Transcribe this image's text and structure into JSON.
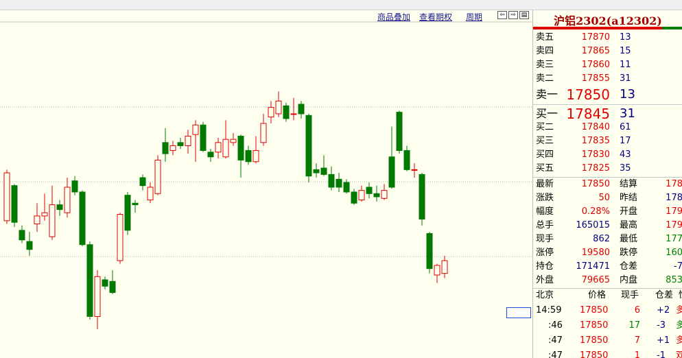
{
  "toolbar": {
    "overlay_label": "商品叠加",
    "options_label": "查看期权",
    "period_label": "周期",
    "nav_icons": [
      "arrow-left-icon",
      "arrow-right-icon",
      "panel-toggle-icon"
    ]
  },
  "instrument": {
    "title": "沪铝2302(a12302)"
  },
  "order_book": {
    "asks": [
      {
        "label": "卖五",
        "price": "17870",
        "volume": "13"
      },
      {
        "label": "卖四",
        "price": "17865",
        "volume": "15"
      },
      {
        "label": "卖三",
        "price": "17860",
        "volume": "11"
      },
      {
        "label": "卖二",
        "price": "17855",
        "volume": "31"
      },
      {
        "label": "卖一",
        "price": "17850",
        "volume": "13"
      }
    ],
    "bids": [
      {
        "label": "买一",
        "price": "17845",
        "volume": "31"
      },
      {
        "label": "买二",
        "price": "17840",
        "volume": "61"
      },
      {
        "label": "买三",
        "price": "17835",
        "volume": "17"
      },
      {
        "label": "买四",
        "price": "17830",
        "volume": "43"
      },
      {
        "label": "买五",
        "price": "17825",
        "volume": "35"
      }
    ]
  },
  "stats": [
    {
      "l1": "最新",
      "v1": "17850",
      "c1": "red",
      "l2": "结算",
      "v2": "178",
      "c2": "red"
    },
    {
      "l1": "涨跌",
      "v1": "50",
      "c1": "red",
      "l2": "昨结",
      "v2": "178",
      "c2": "navy"
    },
    {
      "l1": "幅度",
      "v1": "0.28%",
      "c1": "red",
      "l2": "开盘",
      "v2": "179",
      "c2": "red"
    },
    {
      "l1": "总手",
      "v1": "165015",
      "c1": "navy",
      "l2": "最高",
      "v2": "179",
      "c2": "red"
    },
    {
      "l1": "现手",
      "v1": "862",
      "c1": "navy",
      "l2": "最低",
      "v2": "177",
      "c2": "green"
    },
    {
      "l1": "涨停",
      "v1": "19580",
      "c1": "red",
      "l2": "跌停",
      "v2": "160",
      "c2": "green"
    },
    {
      "l1": "持仓",
      "v1": "171471",
      "c1": "navy",
      "l2": "仓差",
      "v2": "-7",
      "c2": "navy"
    },
    {
      "l1": "外盘",
      "v1": "79665",
      "c1": "red",
      "l2": "内盘",
      "v2": "853",
      "c2": "green"
    }
  ],
  "ticks_header": {
    "time": "北京",
    "price": "价格",
    "volume": "现手",
    "oi": "仓差",
    "type": "性"
  },
  "ticks": [
    {
      "time": "14:59",
      "price": "17850",
      "volume": "6",
      "volume_color": "red",
      "oi": "+2",
      "type": "多",
      "type_color": "red"
    },
    {
      "time": ":46",
      "price": "17850",
      "volume": "17",
      "volume_color": "green",
      "oi": "-3",
      "type": "多",
      "type_color": "green"
    },
    {
      "time": ":47",
      "price": "17850",
      "volume": "7",
      "volume_color": "red",
      "oi": "+1",
      "type": "多",
      "type_color": "red"
    },
    {
      "time": ":47",
      "price": "17850",
      "volume": "1",
      "volume_color": "red",
      "oi": "-1",
      "type": "双",
      "type_color": "red"
    }
  ],
  "colors": {
    "up": "#e00000",
    "down": "#007a00",
    "grid": "#b8b8b8",
    "background": "#fffff0"
  },
  "chart_data": {
    "type": "candlestick",
    "candles": [
      {
        "o": 17455,
        "c": 17605,
        "h": 17615,
        "l": 17445
      },
      {
        "o": 17565,
        "c": 17450,
        "h": 17570,
        "l": 17435
      },
      {
        "o": 17425,
        "c": 17395,
        "h": 17440,
        "l": 17385
      },
      {
        "o": 17390,
        "c": 17365,
        "h": 17420,
        "l": 17345
      },
      {
        "o": 17445,
        "c": 17470,
        "h": 17510,
        "l": 17420
      },
      {
        "o": 17470,
        "c": 17480,
        "h": 17540,
        "l": 17455
      },
      {
        "o": 17405,
        "c": 17505,
        "h": 17565,
        "l": 17395
      },
      {
        "o": 17505,
        "c": 17490,
        "h": 17520,
        "l": 17470
      },
      {
        "o": 17480,
        "c": 17560,
        "h": 17590,
        "l": 17465
      },
      {
        "o": 17580,
        "c": 17545,
        "h": 17595,
        "l": 17535
      },
      {
        "o": 17545,
        "c": 17380,
        "h": 17550,
        "l": 17375
      },
      {
        "o": 17380,
        "c": 17155,
        "h": 17390,
        "l": 17145
      },
      {
        "o": 17155,
        "c": 17280,
        "h": 17300,
        "l": 17115
      },
      {
        "o": 17270,
        "c": 17250,
        "h": 17280,
        "l": 17240
      },
      {
        "o": 17265,
        "c": 17230,
        "h": 17300,
        "l": 17225
      },
      {
        "o": 17330,
        "c": 17475,
        "h": 17480,
        "l": 17320
      },
      {
        "o": 17535,
        "c": 17425,
        "h": 17545,
        "l": 17410
      },
      {
        "o": 17510,
        "c": 17505,
        "h": 17520,
        "l": 17480
      },
      {
        "o": 17590,
        "c": 17565,
        "h": 17600,
        "l": 17550
      },
      {
        "o": 17520,
        "c": 17560,
        "h": 17575,
        "l": 17510
      },
      {
        "o": 17540,
        "c": 17645,
        "h": 17660,
        "l": 17535
      },
      {
        "o": 17700,
        "c": 17665,
        "h": 17745,
        "l": 17640
      },
      {
        "o": 17675,
        "c": 17690,
        "h": 17705,
        "l": 17660
      },
      {
        "o": 17700,
        "c": 17690,
        "h": 17715,
        "l": 17680
      },
      {
        "o": 17690,
        "c": 17720,
        "h": 17740,
        "l": 17665
      },
      {
        "o": 17725,
        "c": 17755,
        "h": 17770,
        "l": 17640
      },
      {
        "o": 17755,
        "c": 17675,
        "h": 17765,
        "l": 17670
      },
      {
        "o": 17670,
        "c": 17655,
        "h": 17680,
        "l": 17640
      },
      {
        "o": 17670,
        "c": 17700,
        "h": 17715,
        "l": 17650
      },
      {
        "o": 17655,
        "c": 17710,
        "h": 17770,
        "l": 17650
      },
      {
        "o": 17700,
        "c": 17710,
        "h": 17730,
        "l": 17690
      },
      {
        "o": 17720,
        "c": 17645,
        "h": 17725,
        "l": 17590
      },
      {
        "o": 17675,
        "c": 17640,
        "h": 17690,
        "l": 17630
      },
      {
        "o": 17640,
        "c": 17675,
        "h": 17720,
        "l": 17635
      },
      {
        "o": 17700,
        "c": 17760,
        "h": 17790,
        "l": 17690
      },
      {
        "o": 17780,
        "c": 17810,
        "h": 17830,
        "l": 17760
      },
      {
        "o": 17790,
        "c": 17830,
        "h": 17860,
        "l": 17780
      },
      {
        "o": 17815,
        "c": 17775,
        "h": 17825,
        "l": 17765
      },
      {
        "o": 17790,
        "c": 17790,
        "h": 17840,
        "l": 17770
      },
      {
        "o": 17820,
        "c": 17790,
        "h": 17830,
        "l": 17775
      },
      {
        "o": 17785,
        "c": 17595,
        "h": 17790,
        "l": 17575
      },
      {
        "o": 17615,
        "c": 17605,
        "h": 17635,
        "l": 17590
      },
      {
        "o": 17620,
        "c": 17600,
        "h": 17660,
        "l": 17595
      },
      {
        "o": 17600,
        "c": 17560,
        "h": 17625,
        "l": 17550
      },
      {
        "o": 17585,
        "c": 17560,
        "h": 17605,
        "l": 17545
      },
      {
        "o": 17575,
        "c": 17545,
        "h": 17585,
        "l": 17540
      },
      {
        "o": 17545,
        "c": 17510,
        "h": 17555,
        "l": 17505
      },
      {
        "o": 17520,
        "c": 17550,
        "h": 17565,
        "l": 17515
      },
      {
        "o": 17560,
        "c": 17540,
        "h": 17575,
        "l": 17525
      },
      {
        "o": 17540,
        "c": 17530,
        "h": 17565,
        "l": 17515
      },
      {
        "o": 17525,
        "c": 17550,
        "h": 17570,
        "l": 17520
      },
      {
        "o": 17655,
        "c": 17560,
        "h": 17750,
        "l": 17555
      },
      {
        "o": 17795,
        "c": 17675,
        "h": 17800,
        "l": 17665
      },
      {
        "o": 17675,
        "c": 17615,
        "h": 17690,
        "l": 17610
      },
      {
        "o": 17615,
        "c": 17615,
        "h": 17635,
        "l": 17590
      },
      {
        "o": 17600,
        "c": 17460,
        "h": 17605,
        "l": 17440
      },
      {
        "o": 17415,
        "c": 17305,
        "h": 17420,
        "l": 17290
      },
      {
        "o": 17285,
        "c": 17315,
        "h": 17320,
        "l": 17260
      },
      {
        "o": 17290,
        "c": 17330,
        "h": 17345,
        "l": 17275
      }
    ],
    "ylim": [
      17100,
      17900
    ],
    "grid": true
  }
}
